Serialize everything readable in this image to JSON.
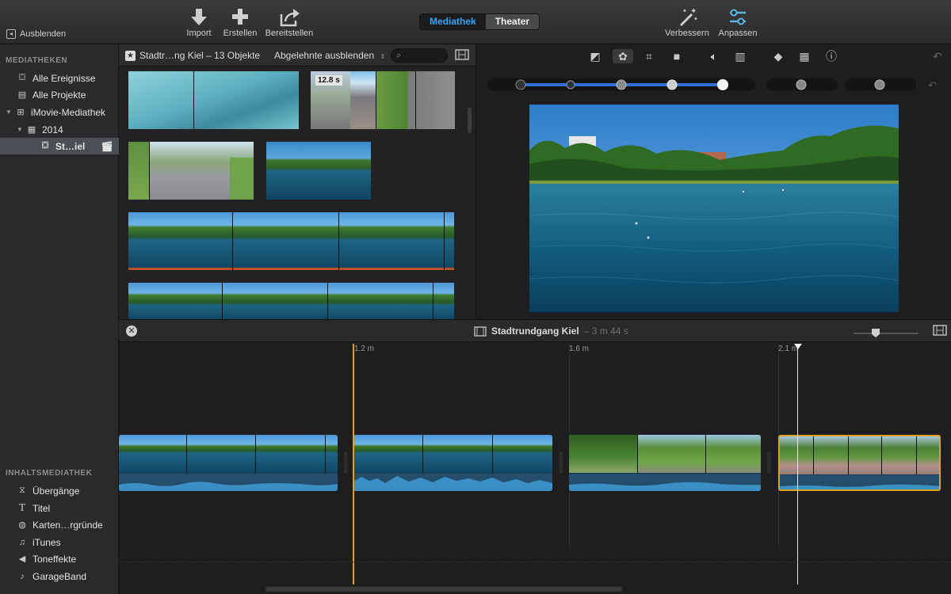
{
  "toolbar": {
    "hide_label": "Ausblenden",
    "import_label": "Import",
    "create_label": "Erstellen",
    "share_label": "Bereitstellen",
    "tab_library": "Mediathek",
    "tab_theater": "Theater",
    "enhance_label": "Verbessern",
    "adjust_label": "Anpassen"
  },
  "sidebar": {
    "libraries_header": "MEDIATHEKEN",
    "items": [
      {
        "label": "Alle Ereignisse"
      },
      {
        "label": "Alle Projekte"
      },
      {
        "label": "iMovie-Mediathek"
      },
      {
        "label": "2014"
      },
      {
        "label": "St…iel"
      }
    ],
    "content_header": "INHALTSMEDIATHEK",
    "content_items": [
      {
        "label": "Übergänge"
      },
      {
        "label": "Titel"
      },
      {
        "label": "Karten…rgründe"
      },
      {
        "label": "iTunes"
      },
      {
        "label": "Toneffekte"
      },
      {
        "label": "GarageBand"
      }
    ]
  },
  "browser": {
    "title": "Stadtr…ng Kiel – 13 Objekte",
    "filter": "Abgelehnte ausblenden",
    "clip_duration": "12.8 s"
  },
  "timeline": {
    "project_title": "Stadtrundgang Kiel",
    "project_duration": "– 3 m 44 s",
    "ruler": [
      "1.2 m",
      "1.6 m",
      "2.1 m"
    ]
  },
  "colors": {
    "accent_blue": "#33a7ff",
    "selection_yellow": "#e0a020"
  }
}
